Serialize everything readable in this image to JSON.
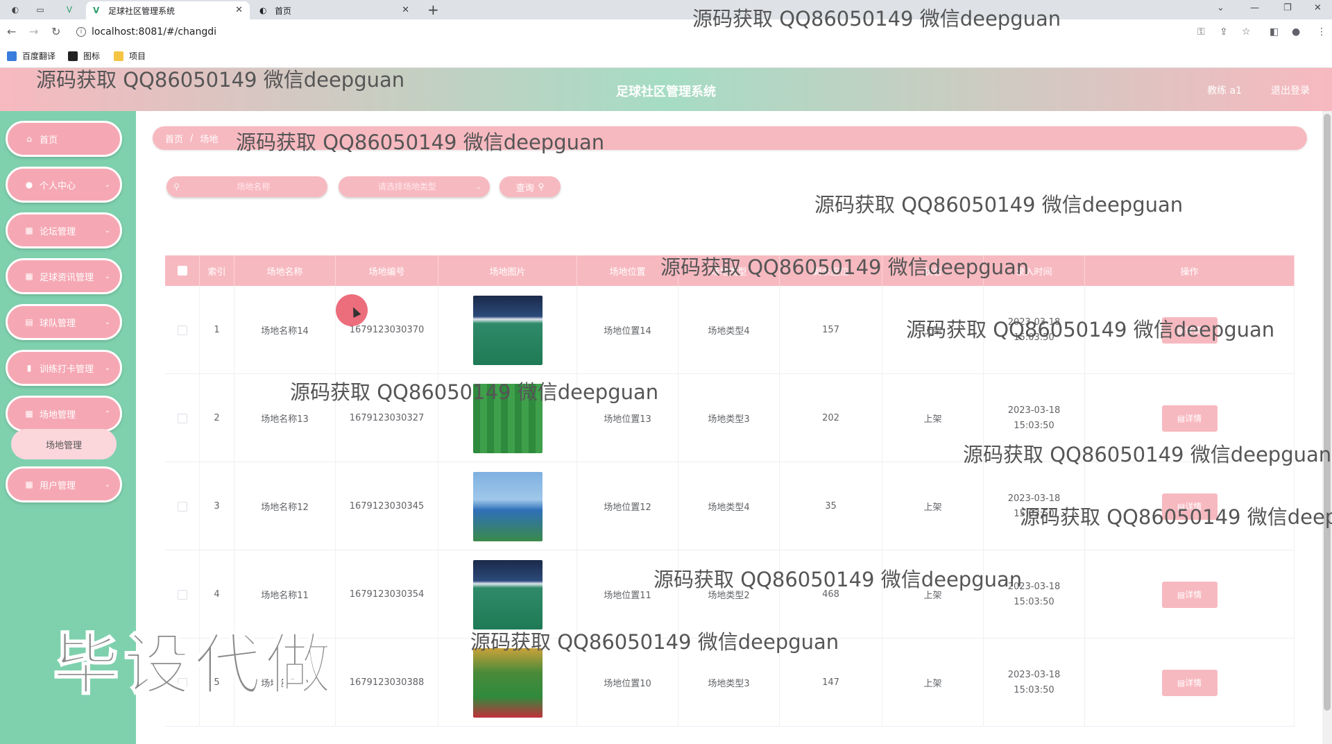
{
  "browser": {
    "tabs": [
      {
        "title": "足球社区管理系统",
        "active": true
      },
      {
        "title": "首页",
        "active": false
      }
    ],
    "url": "localhost:8081/#/changdi",
    "bookmarks": [
      "百度翻译",
      "图标",
      "项目"
    ]
  },
  "header": {
    "title": "足球社区管理系统",
    "user": "教练 a1",
    "logout": "退出登录"
  },
  "sidebar": {
    "items": [
      {
        "label": "首页",
        "icon": "home-icon"
      },
      {
        "label": "个人中心",
        "icon": "user-icon"
      },
      {
        "label": "论坛管理",
        "icon": "grid-icon"
      },
      {
        "label": "足球资讯管理",
        "icon": "grid-icon"
      },
      {
        "label": "球队管理",
        "icon": "clipboard-icon"
      },
      {
        "label": "训练打卡管理",
        "icon": "bar-chart-icon"
      },
      {
        "label": "场地管理",
        "icon": "grid-icon"
      },
      {
        "label": "用户管理",
        "icon": "grid-icon"
      }
    ],
    "submenu_label": "场地管理"
  },
  "breadcrumb": [
    "首页",
    "场地"
  ],
  "search": {
    "name_placeholder": "场地名称",
    "type_placeholder": "请选择场地类型",
    "button_label": "查询"
  },
  "table": {
    "columns": [
      "索引",
      "场地名称",
      "场地编号",
      "场地图片",
      "场地位置",
      "场地类型",
      "剩余座位",
      "状态",
      "录入时间",
      "操作"
    ],
    "rows": [
      {
        "index": "1",
        "name": "场地名称14",
        "code": "1679123030370",
        "location": "场地位置14",
        "type": "场地类型4",
        "seats": "157",
        "status": "上架",
        "time": "2023-03-18 15:03:50",
        "action": "详情",
        "img": "indoor"
      },
      {
        "index": "2",
        "name": "场地名称13",
        "code": "1679123030327",
        "location": "场地位置13",
        "type": "场地类型3",
        "seats": "202",
        "status": "上架",
        "time": "2023-03-18 15:03:50",
        "action": "详情",
        "img": "grass"
      },
      {
        "index": "3",
        "name": "场地名称12",
        "code": "1679123030345",
        "location": "场地位置12",
        "type": "场地类型4",
        "seats": "35",
        "status": "上架",
        "time": "2023-03-18 15:03:50",
        "action": "详情",
        "img": "tennis"
      },
      {
        "index": "4",
        "name": "场地名称11",
        "code": "1679123030354",
        "location": "场地位置11",
        "type": "场地类型2",
        "seats": "468",
        "status": "上架",
        "time": "2023-03-18 15:03:50",
        "action": "详情",
        "img": "indoor"
      },
      {
        "index": "5",
        "name": "场地名称10",
        "code": "1679123030388",
        "location": "场地位置10",
        "type": "场地类型3",
        "seats": "147",
        "status": "上架",
        "time": "2023-03-18 15:03:50",
        "action": "详情",
        "img": "track"
      }
    ]
  },
  "watermarks": {
    "text": "源码获取 QQ86050149 微信deepguan",
    "big": "毕设代做"
  },
  "colors": {
    "pink": "#f7b9c0",
    "green": "#7fd1ae",
    "header_gradient_mid": "#a6dcc4"
  }
}
